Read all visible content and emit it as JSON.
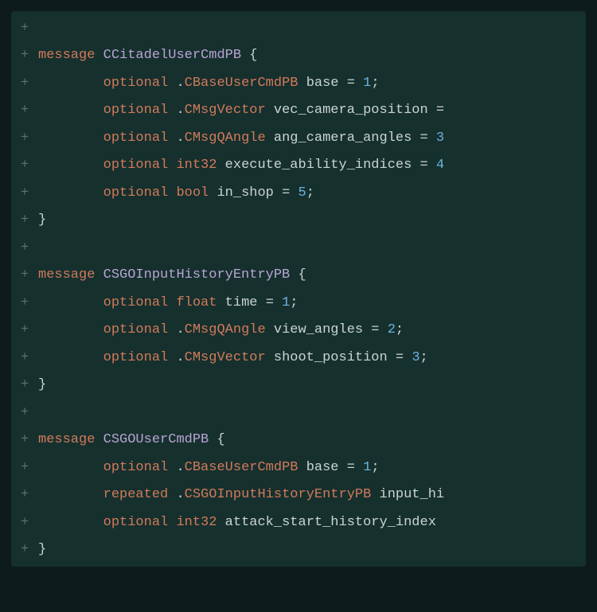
{
  "lines": [
    {
      "marker": "+",
      "indent": 0,
      "tokens": []
    },
    {
      "marker": "+",
      "indent": 0,
      "tokens": [
        {
          "t": "message ",
          "c": "kw-message"
        },
        {
          "t": "CCitadelUserCmdPB ",
          "c": "msg-name"
        },
        {
          "t": "{",
          "c": "brace"
        }
      ]
    },
    {
      "marker": "+",
      "indent": 1,
      "tokens": [
        {
          "t": "optional ",
          "c": "kw-optional"
        },
        {
          "t": ".",
          "c": "dot"
        },
        {
          "t": "CBaseUserCmdPB ",
          "c": "type-user"
        },
        {
          "t": "base ",
          "c": "field-name"
        },
        {
          "t": "= ",
          "c": "eq"
        },
        {
          "t": "1",
          "c": "num"
        },
        {
          "t": ";",
          "c": "punct"
        }
      ]
    },
    {
      "marker": "+",
      "indent": 1,
      "tokens": [
        {
          "t": "optional ",
          "c": "kw-optional"
        },
        {
          "t": ".",
          "c": "dot"
        },
        {
          "t": "CMsgVector ",
          "c": "type-user"
        },
        {
          "t": "vec_camera_position ",
          "c": "field-name"
        },
        {
          "t": "=",
          "c": "eq"
        }
      ]
    },
    {
      "marker": "+",
      "indent": 1,
      "tokens": [
        {
          "t": "optional ",
          "c": "kw-optional"
        },
        {
          "t": ".",
          "c": "dot"
        },
        {
          "t": "CMsgQAngle ",
          "c": "type-user"
        },
        {
          "t": "ang_camera_angles ",
          "c": "field-name"
        },
        {
          "t": "= ",
          "c": "eq"
        },
        {
          "t": "3",
          "c": "num"
        }
      ]
    },
    {
      "marker": "+",
      "indent": 1,
      "tokens": [
        {
          "t": "optional ",
          "c": "kw-optional"
        },
        {
          "t": "int32 ",
          "c": "type-prim"
        },
        {
          "t": "execute_ability_indices ",
          "c": "field-name"
        },
        {
          "t": "= ",
          "c": "eq"
        },
        {
          "t": "4",
          "c": "num"
        }
      ]
    },
    {
      "marker": "+",
      "indent": 1,
      "tokens": [
        {
          "t": "optional ",
          "c": "kw-optional"
        },
        {
          "t": "bool ",
          "c": "type-prim"
        },
        {
          "t": "in_shop ",
          "c": "field-name"
        },
        {
          "t": "= ",
          "c": "eq"
        },
        {
          "t": "5",
          "c": "num"
        },
        {
          "t": ";",
          "c": "punct"
        }
      ]
    },
    {
      "marker": "+",
      "indent": 0,
      "tokens": [
        {
          "t": "}",
          "c": "brace"
        }
      ]
    },
    {
      "marker": "+",
      "indent": 0,
      "tokens": []
    },
    {
      "marker": "+",
      "indent": 0,
      "tokens": [
        {
          "t": "message ",
          "c": "kw-message"
        },
        {
          "t": "CSGOInputHistoryEntryPB ",
          "c": "msg-name"
        },
        {
          "t": "{",
          "c": "brace"
        }
      ]
    },
    {
      "marker": "+",
      "indent": 1,
      "tokens": [
        {
          "t": "optional ",
          "c": "kw-optional"
        },
        {
          "t": "float ",
          "c": "type-prim"
        },
        {
          "t": "time ",
          "c": "field-name"
        },
        {
          "t": "= ",
          "c": "eq"
        },
        {
          "t": "1",
          "c": "num"
        },
        {
          "t": ";",
          "c": "punct"
        }
      ]
    },
    {
      "marker": "+",
      "indent": 1,
      "tokens": [
        {
          "t": "optional ",
          "c": "kw-optional"
        },
        {
          "t": ".",
          "c": "dot"
        },
        {
          "t": "CMsgQAngle ",
          "c": "type-user"
        },
        {
          "t": "view_angles ",
          "c": "field-name"
        },
        {
          "t": "= ",
          "c": "eq"
        },
        {
          "t": "2",
          "c": "num"
        },
        {
          "t": ";",
          "c": "punct"
        }
      ]
    },
    {
      "marker": "+",
      "indent": 1,
      "tokens": [
        {
          "t": "optional ",
          "c": "kw-optional"
        },
        {
          "t": ".",
          "c": "dot"
        },
        {
          "t": "CMsgVector ",
          "c": "type-user"
        },
        {
          "t": "shoot_position ",
          "c": "field-name"
        },
        {
          "t": "= ",
          "c": "eq"
        },
        {
          "t": "3",
          "c": "num"
        },
        {
          "t": ";",
          "c": "punct"
        }
      ]
    },
    {
      "marker": "+",
      "indent": 0,
      "tokens": [
        {
          "t": "}",
          "c": "brace"
        }
      ]
    },
    {
      "marker": "+",
      "indent": 0,
      "tokens": []
    },
    {
      "marker": "+",
      "indent": 0,
      "tokens": [
        {
          "t": "message ",
          "c": "kw-message"
        },
        {
          "t": "CSGOUserCmdPB ",
          "c": "msg-name"
        },
        {
          "t": "{",
          "c": "brace"
        }
      ]
    },
    {
      "marker": "+",
      "indent": 1,
      "tokens": [
        {
          "t": "optional ",
          "c": "kw-optional"
        },
        {
          "t": ".",
          "c": "dot"
        },
        {
          "t": "CBaseUserCmdPB ",
          "c": "type-user"
        },
        {
          "t": "base ",
          "c": "field-name"
        },
        {
          "t": "= ",
          "c": "eq"
        },
        {
          "t": "1",
          "c": "num"
        },
        {
          "t": ";",
          "c": "punct"
        }
      ]
    },
    {
      "marker": "+",
      "indent": 1,
      "tokens": [
        {
          "t": "repeated ",
          "c": "kw-repeated"
        },
        {
          "t": ".",
          "c": "dot"
        },
        {
          "t": "CSGOInputHistoryEntryPB ",
          "c": "type-user"
        },
        {
          "t": "input_hi",
          "c": "field-name"
        }
      ]
    },
    {
      "marker": "+",
      "indent": 1,
      "tokens": [
        {
          "t": "optional ",
          "c": "kw-optional"
        },
        {
          "t": "int32 ",
          "c": "type-prim"
        },
        {
          "t": "attack_start_history_index",
          "c": "field-name"
        }
      ]
    },
    {
      "marker": "+",
      "indent": 0,
      "tokens": [
        {
          "t": "}",
          "c": "brace"
        }
      ]
    }
  ]
}
